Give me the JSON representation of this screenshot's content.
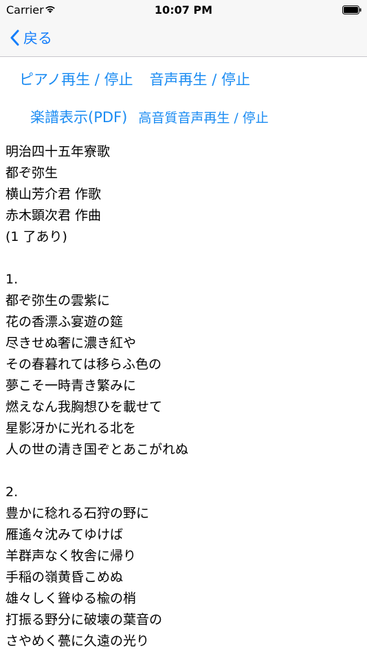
{
  "status_bar": {
    "carrier": "Carrier",
    "time": "10:07 PM"
  },
  "nav": {
    "back_label": "戻る"
  },
  "controls": {
    "piano": "ピアノ再生 / 停止",
    "voice": "音声再生 / 停止",
    "score": "楽譜表示(PDF)",
    "hq_voice": "高音質音声再生 / 停止"
  },
  "lyrics": [
    "明治四十五年寮歌",
    "都ぞ弥生",
    "横山芳介君 作歌",
    "赤木顕次君 作曲",
    "(1 了あり)",
    "",
    "1.",
    "都ぞ弥生の雲紫に",
    "花の香漂ふ宴遊の筵",
    "尽きせぬ奢に濃き紅や",
    "その春暮れては移らふ色の",
    "夢こそ一時青き繁みに",
    "燃えなん我胸想ひを載せて",
    "星影冴かに光れる北を",
    "人の世の清き国ぞとあこがれぬ",
    "",
    "2.",
    "豊かに稔れる石狩の野に",
    "雁遙々沈みてゆけば",
    "羊群声なく牧舎に帰り",
    "手稲の嶺黄昏こめぬ",
    "雄々しく聳ゆる楡の梢",
    "打振る野分に破壊の葉音の",
    "さやめく甍に久遠の光り"
  ]
}
